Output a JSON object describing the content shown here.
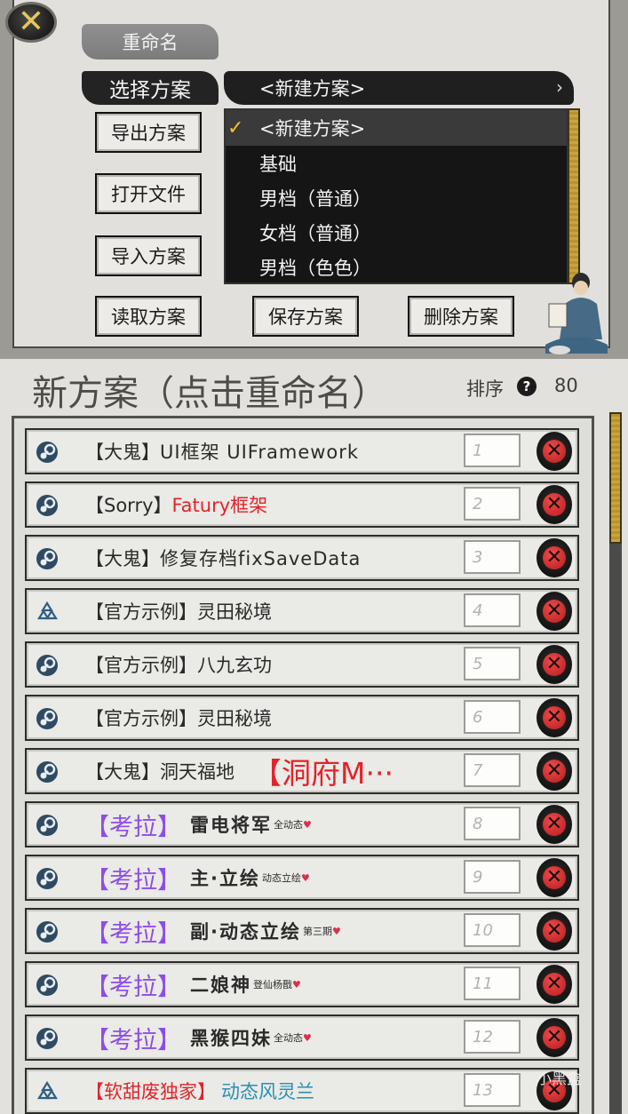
{
  "top_panel": {
    "rename_button": "重命名",
    "select_scheme_label": "选择方案",
    "selected_scheme": "<新建方案>",
    "export_button": "导出方案",
    "open_file_button": "打开文件",
    "import_button": "导入方案",
    "load_button": "读取方案",
    "save_button": "保存方案",
    "delete_button": "删除方案",
    "dropdown_options": [
      {
        "label": "<新建方案>",
        "checked": true
      },
      {
        "label": "基础",
        "checked": false
      },
      {
        "label": "男档（普通）",
        "checked": false
      },
      {
        "label": "女档（普通）",
        "checked": false
      },
      {
        "label": "男档（色色）",
        "checked": false
      }
    ]
  },
  "header": {
    "scheme_title": "新方案（点击重命名）",
    "sort_label": "排序",
    "count": "80"
  },
  "mods": [
    {
      "icon": "steam-icon",
      "prefix": "【大鬼】",
      "name": "UI框架 UIFramework",
      "order": "1"
    },
    {
      "icon": "steam-icon",
      "prefix": "【Sorry】",
      "name": "Fatury框架",
      "order": "2"
    },
    {
      "icon": "steam-icon",
      "prefix": "【大鬼】",
      "name": "修复存档fixSaveData",
      "order": "3"
    },
    {
      "icon": "recycle-icon",
      "prefix": "【官方示例】",
      "name": "灵田秘境",
      "order": "4"
    },
    {
      "icon": "steam-icon",
      "prefix": "【官方示例】",
      "name": "八九玄功",
      "order": "5"
    },
    {
      "icon": "steam-icon",
      "prefix": "【官方示例】",
      "name": "灵田秘境",
      "order": "6"
    },
    {
      "icon": "steam-icon",
      "prefix": "【大鬼】",
      "name": "洞天福地",
      "suffix": "【洞府M···",
      "order": "7"
    },
    {
      "icon": "steam-icon",
      "prefix": "【考拉】",
      "name": "雷电将军",
      "sup": "全动态",
      "order": "8"
    },
    {
      "icon": "steam-icon",
      "prefix": "【考拉】",
      "name": "主·立绘",
      "sup": "动态立绘",
      "order": "9"
    },
    {
      "icon": "steam-icon",
      "prefix": "【考拉】",
      "name": "副·动态立绘",
      "sup": "第三期",
      "order": "10"
    },
    {
      "icon": "steam-icon",
      "prefix": "【考拉】",
      "name": "二娘神",
      "sup": "登仙杨戬",
      "order": "11"
    },
    {
      "icon": "steam-icon",
      "prefix": "【考拉】",
      "name": "黑猴四妹",
      "sup": "全动态",
      "order": "12"
    },
    {
      "icon": "recycle-icon",
      "prefix": "【软甜废独家】",
      "name": "动态风灵兰",
      "order": "13"
    }
  ],
  "watermark": "小黑盒",
  "colors": {
    "red_text": "#e0242a",
    "purple_text": "#8d4de8",
    "teal_text": "#2a8fb0",
    "gold": "#c9a53a"
  }
}
